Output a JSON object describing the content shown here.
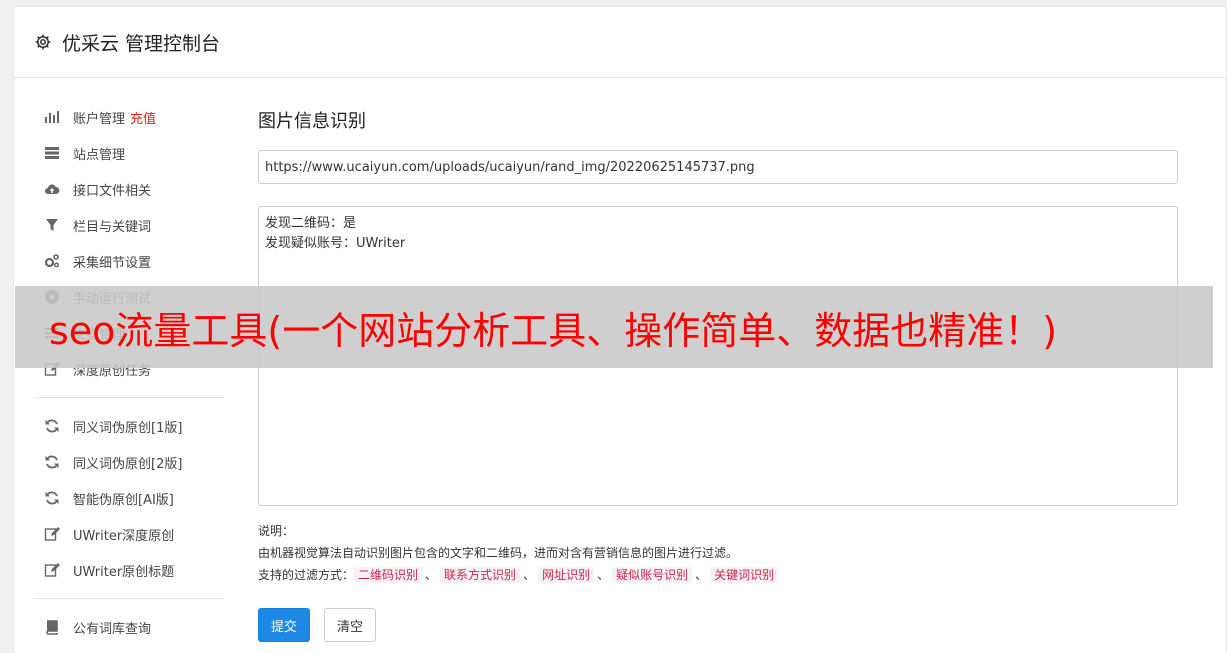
{
  "header": {
    "title": "优采云 管理控制台"
  },
  "sidebar": {
    "group1": [
      {
        "label": "账户管理",
        "extra": "充值",
        "icon": "bar-chart-icon"
      },
      {
        "label": "站点管理",
        "icon": "server-icon"
      },
      {
        "label": "接口文件相关",
        "icon": "cloud-upload-icon"
      },
      {
        "label": "栏目与关键词",
        "icon": "filter-icon"
      },
      {
        "label": "采集细节设置",
        "icon": "gears-icon"
      },
      {
        "label": "手动运行测试",
        "icon": "play-circle-icon"
      },
      {
        "label": "文章管理",
        "icon": "list-icon"
      },
      {
        "label": "深度原创任务",
        "icon": "edit-icon"
      }
    ],
    "group2": [
      {
        "label": "同义词伪原创[1版]",
        "icon": "refresh-icon"
      },
      {
        "label": "同义词伪原创[2版]",
        "icon": "refresh-icon"
      },
      {
        "label": "智能伪原创[AI版]",
        "icon": "refresh-icon"
      },
      {
        "label": "UWriter深度原创",
        "icon": "edit-icon"
      },
      {
        "label": "UWriter原创标题",
        "icon": "edit-icon"
      }
    ],
    "group3": [
      {
        "label": "公有词库查询",
        "icon": "book-icon"
      }
    ]
  },
  "main": {
    "title": "图片信息识别",
    "url_value": "https://www.ucaiyun.com/uploads/ucaiyun/rand_img/20220625145737.png",
    "result_lines": [
      "发现二维码：是",
      "发现疑似账号：UWriter"
    ],
    "notes_label": "说明：",
    "notes_desc": "由机器视觉算法自动识别图片包含的文字和二维码，进而对含有营销信息的图片进行过滤。",
    "filters_label": "支持的过滤方式：",
    "filters": [
      "二维码识别",
      "联系方式识别",
      "网址识别",
      "疑似账号识别",
      "关键词识别"
    ],
    "filter_sep": "、",
    "submit_label": "提交",
    "clear_label": "清空"
  },
  "banner": {
    "text": "seo流量工具(一个网站分析工具、操作简单、数据也精准！)"
  }
}
